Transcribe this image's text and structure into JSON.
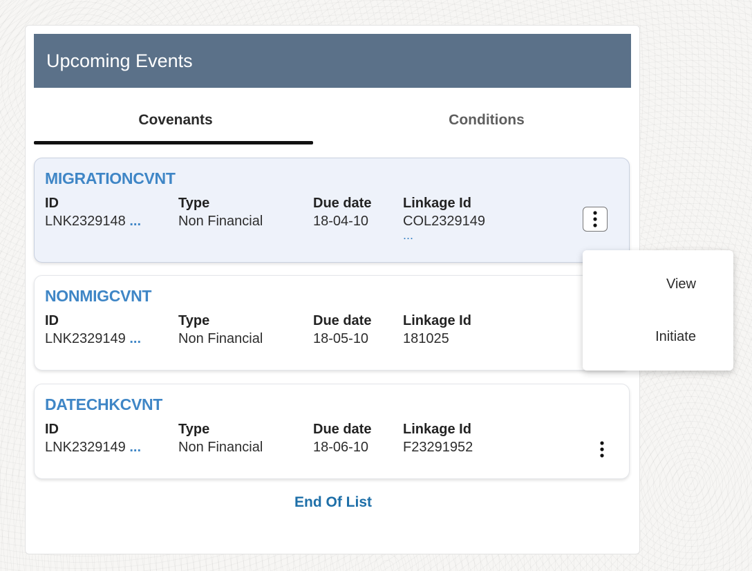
{
  "panel": {
    "title": "Upcoming Events",
    "tabs": [
      {
        "label": "Covenants",
        "selected": true
      },
      {
        "label": "Conditions",
        "selected": false
      }
    ],
    "column_labels": {
      "id": "ID",
      "type": "Type",
      "due_date": "Due date",
      "linkage_id": "Linkage Id"
    },
    "cards": [
      {
        "name": "MIGRATIONCVNT",
        "id": "LNK2329148",
        "type": "Non Financial",
        "due_date": "18-04-10",
        "linkage_id": "COL2329149",
        "linkage_more": "..."
      },
      {
        "name": "NONMIGCVNT",
        "id": "LNK2329149",
        "type": "Non Financial",
        "due_date": "18-05-10",
        "linkage_id": "181025"
      },
      {
        "name": "DATECHKCVNT",
        "id": "LNK2329149",
        "type": "Non Financial",
        "due_date": "18-06-10",
        "linkage_id": "F23291952"
      }
    ],
    "id_ellipsis": "...",
    "end_of_list": "End Of List"
  },
  "context_menu": {
    "items": [
      "View",
      "Initiate"
    ]
  },
  "colors": {
    "header_bg": "#5b7189",
    "accent_link": "#3f86c6",
    "end_of_list": "#1e6fa8"
  },
  "icons": [
    "kebab-menu-icon"
  ]
}
